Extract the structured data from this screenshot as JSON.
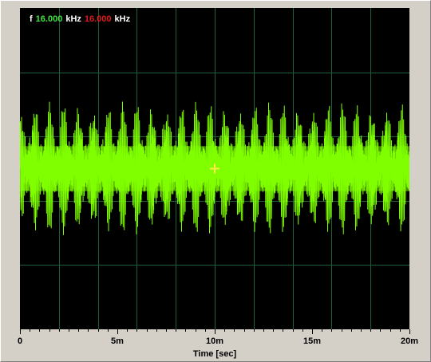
{
  "readout": {
    "prefix": "f",
    "freq1_value": "16.000",
    "freq1_unit": "kHz",
    "freq2_value": "16.000",
    "freq2_unit": "kHz"
  },
  "x_axis": {
    "title": "Time [sec]",
    "tick_labels": [
      "0",
      "5m",
      "10m",
      "15m",
      "20m"
    ]
  },
  "colors": {
    "background": "#000000",
    "grid": "#1f5f3a",
    "trace": "#7fff00",
    "cursor": "#ffe84a",
    "freq1": "#3fe33f",
    "freq2": "#e11a1a",
    "panel": "#d4d0c8"
  },
  "chart_data": {
    "type": "line",
    "title": "",
    "xlabel": "Time [sec]",
    "ylabel": "",
    "x_range_ms": [
      0,
      20
    ],
    "y_range": [
      -1,
      1
    ],
    "grid": true,
    "signal": {
      "frequency_khz": 16.0,
      "frequency2_khz": 16.0,
      "envelope_amplitude": 0.3,
      "inner_amplitude": 0.12
    },
    "cursor_time_ms": 10
  }
}
